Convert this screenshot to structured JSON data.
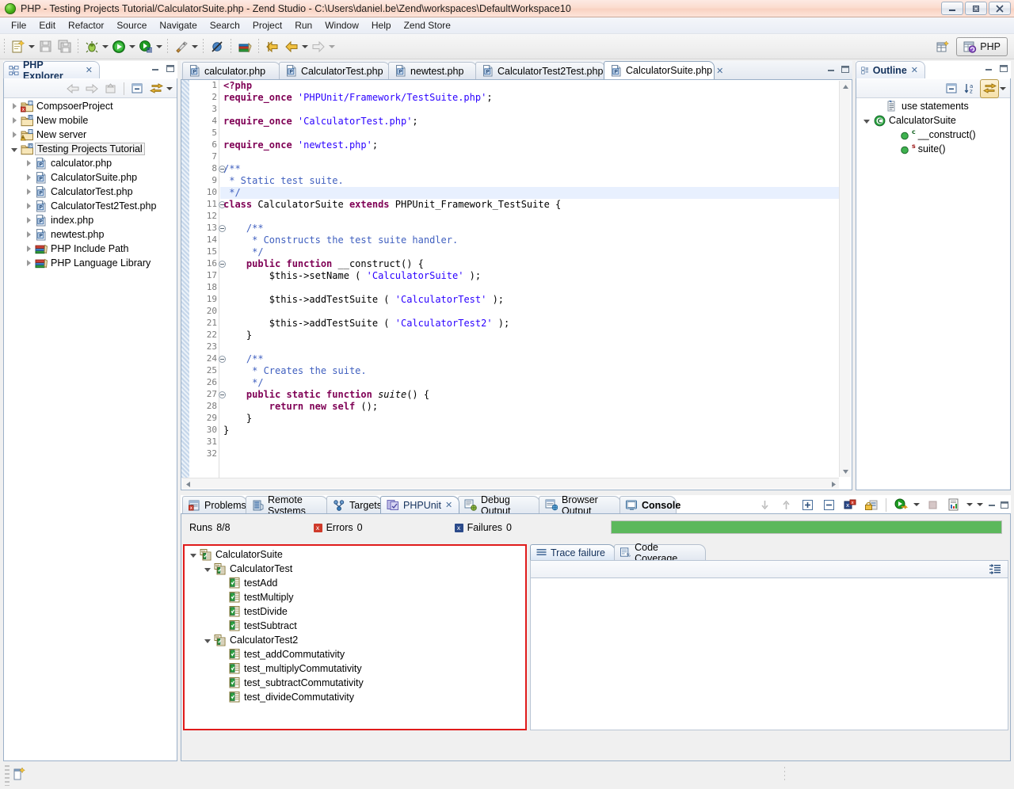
{
  "window": {
    "title": "PHP - Testing Projects Tutorial/CalculatorSuite.php - Zend Studio - C:\\Users\\daniel.be\\Zend\\workspaces\\DefaultWorkspace10",
    "minimize_label": "–",
    "maximize_label": "❐",
    "close_label": "✕"
  },
  "menu": {
    "items": [
      {
        "label": "File"
      },
      {
        "label": "Edit"
      },
      {
        "label": "Refactor"
      },
      {
        "label": "Source"
      },
      {
        "label": "Navigate"
      },
      {
        "label": "Search"
      },
      {
        "label": "Project"
      },
      {
        "label": "Run"
      },
      {
        "label": "Window"
      },
      {
        "label": "Help"
      },
      {
        "label": "Zend Store"
      }
    ]
  },
  "toolbar": {
    "buttons": [
      {
        "name": "new-wizard-icon",
        "tooltip": "New"
      },
      {
        "name": "save-icon",
        "tooltip": "Save"
      },
      {
        "name": "save-all-icon",
        "tooltip": "Save All"
      },
      {
        "name": "debug-icon",
        "tooltip": "Debug"
      },
      {
        "name": "run-icon",
        "tooltip": "Run"
      },
      {
        "name": "profile-icon",
        "tooltip": "Profile"
      },
      {
        "name": "launch-icon",
        "tooltip": "Run As"
      },
      {
        "name": "toggle-breakpoint-icon",
        "tooltip": "Skip All Breakpoints"
      },
      {
        "name": "open-type-icon",
        "tooltip": "Open Type"
      },
      {
        "name": "back-icon",
        "tooltip": "Back"
      },
      {
        "name": "previous-edit-icon",
        "tooltip": "Previous Edit Location"
      },
      {
        "name": "forward-icon",
        "tooltip": "Forward"
      }
    ],
    "perspective_label": "PHP",
    "open_perspective_tooltip": "Open Perspective"
  },
  "explorer": {
    "title": "PHP Explorer",
    "close_glyph": "✕",
    "toolbar": [
      {
        "name": "back-icon"
      },
      {
        "name": "forward-icon"
      },
      {
        "name": "up-icon"
      },
      {
        "name": "collapse-all-icon"
      },
      {
        "name": "link-with-editor-icon"
      },
      {
        "name": "view-menu-icon"
      }
    ],
    "tree": [
      {
        "label": "CompsoerProject",
        "indent": 0,
        "twist": "collapsed",
        "icon": "project-error-icon"
      },
      {
        "label": "New mobile",
        "indent": 0,
        "twist": "collapsed",
        "icon": "project-icon"
      },
      {
        "label": "New server",
        "indent": 0,
        "twist": "collapsed",
        "icon": "project-warning-icon"
      },
      {
        "label": "Testing Projects Tutorial",
        "indent": 0,
        "twist": "expanded",
        "icon": "project-icon",
        "selected": true
      },
      {
        "label": "calculator.php",
        "indent": 1,
        "twist": "collapsed",
        "icon": "php-file-icon"
      },
      {
        "label": "CalculatorSuite.php",
        "indent": 1,
        "twist": "collapsed",
        "icon": "php-file-icon"
      },
      {
        "label": "CalculatorTest.php",
        "indent": 1,
        "twist": "collapsed",
        "icon": "php-file-icon"
      },
      {
        "label": "CalculatorTest2Test.php",
        "indent": 1,
        "twist": "collapsed",
        "icon": "php-file-icon"
      },
      {
        "label": "index.php",
        "indent": 1,
        "twist": "collapsed",
        "icon": "php-file-icon"
      },
      {
        "label": "newtest.php",
        "indent": 1,
        "twist": "collapsed",
        "icon": "php-file-icon"
      },
      {
        "label": "PHP Include Path",
        "indent": 1,
        "twist": "collapsed",
        "icon": "library-icon"
      },
      {
        "label": "PHP Language Library",
        "indent": 1,
        "twist": "collapsed",
        "icon": "library-icon"
      }
    ]
  },
  "editor": {
    "tabs": [
      {
        "label": "calculator.php",
        "active": false
      },
      {
        "label": "CalculatorTest.php",
        "active": false
      },
      {
        "label": "newtest.php",
        "active": false
      },
      {
        "label": "CalculatorTest2Test.php",
        "active": false
      },
      {
        "label": "CalculatorSuite.php",
        "active": true,
        "close_glyph": "✕"
      }
    ],
    "minimize_glyph": "–",
    "maximize_glyph": "❐",
    "highlighted_line": 10,
    "fold_lines": [
      8,
      11,
      13,
      16,
      24,
      27
    ],
    "total_lines": 32,
    "lines": [
      {
        "n": 1,
        "tokens": [
          {
            "t": "<?php",
            "c": "k"
          }
        ]
      },
      {
        "n": 2,
        "tokens": [
          {
            "t": "require_once ",
            "c": "k"
          },
          {
            "t": "'PHPUnit/Framework/TestSuite.php'",
            "c": "s"
          },
          {
            "t": ";",
            "c": "t"
          }
        ]
      },
      {
        "n": 3,
        "tokens": []
      },
      {
        "n": 4,
        "tokens": [
          {
            "t": "require_once ",
            "c": "k"
          },
          {
            "t": "'CalculatorTest.php'",
            "c": "s"
          },
          {
            "t": ";",
            "c": "t"
          }
        ]
      },
      {
        "n": 5,
        "tokens": []
      },
      {
        "n": 6,
        "tokens": [
          {
            "t": "require_once ",
            "c": "k"
          },
          {
            "t": "'newtest.php'",
            "c": "s"
          },
          {
            "t": ";",
            "c": "t"
          }
        ]
      },
      {
        "n": 7,
        "tokens": []
      },
      {
        "n": 8,
        "tokens": [
          {
            "t": "/**",
            "c": "c"
          }
        ]
      },
      {
        "n": 9,
        "tokens": [
          {
            "t": " * Static test suite.",
            "c": "c"
          }
        ]
      },
      {
        "n": 10,
        "tokens": [
          {
            "t": " */",
            "c": "c"
          }
        ]
      },
      {
        "n": 11,
        "tokens": [
          {
            "t": "class ",
            "c": "k"
          },
          {
            "t": "CalculatorSuite ",
            "c": "t"
          },
          {
            "t": "extends ",
            "c": "k"
          },
          {
            "t": "PHPUnit_Framework_TestSuite {",
            "c": "t"
          }
        ]
      },
      {
        "n": 12,
        "tokens": []
      },
      {
        "n": 13,
        "tokens": [
          {
            "t": "    /**",
            "c": "c"
          }
        ]
      },
      {
        "n": 14,
        "tokens": [
          {
            "t": "     * Constructs the test suite handler.",
            "c": "c"
          }
        ]
      },
      {
        "n": 15,
        "tokens": [
          {
            "t": "     */",
            "c": "c"
          }
        ]
      },
      {
        "n": 16,
        "tokens": [
          {
            "t": "    public function ",
            "c": "k"
          },
          {
            "t": "__construct() {",
            "c": "t"
          }
        ]
      },
      {
        "n": 17,
        "tokens": [
          {
            "t": "        $this->setName ( ",
            "c": "t"
          },
          {
            "t": "'CalculatorSuite'",
            "c": "s"
          },
          {
            "t": " );",
            "c": "t"
          }
        ]
      },
      {
        "n": 18,
        "tokens": []
      },
      {
        "n": 19,
        "tokens": [
          {
            "t": "        $this->addTestSuite ( ",
            "c": "t"
          },
          {
            "t": "'CalculatorTest'",
            "c": "s"
          },
          {
            "t": " );",
            "c": "t"
          }
        ]
      },
      {
        "n": 20,
        "tokens": []
      },
      {
        "n": 21,
        "tokens": [
          {
            "t": "        $this->addTestSuite ( ",
            "c": "t"
          },
          {
            "t": "'CalculatorTest2'",
            "c": "s"
          },
          {
            "t": " );",
            "c": "t"
          }
        ]
      },
      {
        "n": 22,
        "tokens": [
          {
            "t": "    }",
            "c": "t"
          }
        ]
      },
      {
        "n": 23,
        "tokens": []
      },
      {
        "n": 24,
        "tokens": [
          {
            "t": "    /**",
            "c": "c"
          }
        ]
      },
      {
        "n": 25,
        "tokens": [
          {
            "t": "     * Creates the suite.",
            "c": "c"
          }
        ]
      },
      {
        "n": 26,
        "tokens": [
          {
            "t": "     */",
            "c": "c"
          }
        ]
      },
      {
        "n": 27,
        "tokens": [
          {
            "t": "    public static function ",
            "c": "k"
          },
          {
            "t": "suite",
            "c": "t ital"
          },
          {
            "t": "() {",
            "c": "t"
          }
        ]
      },
      {
        "n": 28,
        "tokens": [
          {
            "t": "        return new self ",
            "c": "k"
          },
          {
            "t": "();",
            "c": "t"
          }
        ]
      },
      {
        "n": 29,
        "tokens": [
          {
            "t": "    }",
            "c": "t"
          }
        ]
      },
      {
        "n": 30,
        "tokens": [
          {
            "t": "}",
            "c": "t"
          }
        ]
      },
      {
        "n": 31,
        "tokens": []
      },
      {
        "n": 32,
        "tokens": []
      }
    ]
  },
  "outline": {
    "title": "Outline",
    "close_glyph": "✕",
    "toolbar": [
      {
        "name": "collapse-all-icon"
      },
      {
        "name": "sort-icon"
      },
      {
        "name": "link-with-editor-icon"
      },
      {
        "name": "view-menu-icon"
      }
    ],
    "tree": [
      {
        "label": "use statements",
        "indent": 1,
        "twist": "none",
        "icon": "use-statements-icon"
      },
      {
        "label": "CalculatorSuite",
        "indent": 0,
        "twist": "expanded",
        "icon": "class-icon"
      },
      {
        "label": "__construct()",
        "indent": 2,
        "twist": "none",
        "icon": "method-public-icon",
        "badge": "c"
      },
      {
        "label": "suite()",
        "indent": 2,
        "twist": "none",
        "icon": "method-public-icon",
        "badge": "s"
      }
    ]
  },
  "bottom": {
    "tabs": [
      {
        "label": "Problems",
        "icon": "problems-icon",
        "active": false,
        "bold": false
      },
      {
        "label": "Remote Systems",
        "icon": "remote-systems-icon",
        "active": false,
        "bold": false
      },
      {
        "label": "Targets",
        "icon": "targets-icon",
        "active": false,
        "bold": false
      },
      {
        "label": "PHPUnit",
        "icon": "phpunit-icon",
        "active": true,
        "bold": false,
        "close_glyph": "✕"
      },
      {
        "label": "Debug Output",
        "icon": "debug-output-icon",
        "active": false,
        "bold": false
      },
      {
        "label": "Browser Output",
        "icon": "browser-output-icon",
        "active": false,
        "bold": false
      },
      {
        "label": "Console",
        "icon": "console-icon",
        "active": false,
        "bold": true
      }
    ],
    "toolbar": [
      {
        "name": "next-failure-icon"
      },
      {
        "name": "previous-failure-icon"
      },
      {
        "name": "expand-all-icon"
      },
      {
        "name": "collapse-all-icon"
      },
      {
        "name": "show-failures-only-icon"
      },
      {
        "name": "lock-scroll-icon"
      },
      {
        "name": "rerun-test-icon"
      },
      {
        "name": "rerun-dropdown-icon"
      },
      {
        "name": "stop-icon"
      },
      {
        "name": "report-icon"
      },
      {
        "name": "report-dropdown-icon"
      },
      {
        "name": "view-menu-icon"
      },
      {
        "name": "minimize-icon"
      },
      {
        "name": "maximize-icon"
      }
    ],
    "status": {
      "runs_label": "Runs",
      "runs_value": "8/8",
      "errors_label": "Errors",
      "errors_value": "0",
      "failures_label": "Failures",
      "failures_value": "0",
      "progress_percent": 100,
      "progress_color": "#5cb85c"
    },
    "test_tree": [
      {
        "label": "CalculatorSuite",
        "indent": 0,
        "twist": "expanded",
        "icon": "test-suite-icon"
      },
      {
        "label": "CalculatorTest",
        "indent": 1,
        "twist": "expanded",
        "icon": "test-suite-icon"
      },
      {
        "label": "testAdd",
        "indent": 2,
        "twist": "none",
        "icon": "test-case-icon"
      },
      {
        "label": "testMultiply",
        "indent": 2,
        "twist": "none",
        "icon": "test-case-icon"
      },
      {
        "label": "testDivide",
        "indent": 2,
        "twist": "none",
        "icon": "test-case-icon"
      },
      {
        "label": "testSubtract",
        "indent": 2,
        "twist": "none",
        "icon": "test-case-icon"
      },
      {
        "label": "CalculatorTest2",
        "indent": 1,
        "twist": "expanded",
        "icon": "test-suite-icon"
      },
      {
        "label": "test_addCommutativity",
        "indent": 2,
        "twist": "none",
        "icon": "test-case-icon"
      },
      {
        "label": "test_multiplyCommutativity",
        "indent": 2,
        "twist": "none",
        "icon": "test-case-icon"
      },
      {
        "label": "test_subtractCommutativity",
        "indent": 2,
        "twist": "none",
        "icon": "test-case-icon"
      },
      {
        "label": "test_divideCommutativity",
        "indent": 2,
        "twist": "none",
        "icon": "test-case-icon"
      }
    ],
    "trace": {
      "tabs": [
        {
          "label": "Trace failure",
          "icon": "trace-failure-icon",
          "active": true
        },
        {
          "label": "Code Coverage",
          "icon": "code-coverage-icon",
          "active": false
        }
      ],
      "toolbar": [
        {
          "name": "filter-stack-trace-icon"
        }
      ],
      "content": ""
    }
  },
  "statusbar": {
    "left_icon": "writable-indicator-icon",
    "text": ""
  },
  "colors": {
    "titlebar": "#fbdccf",
    "accent_tab": "#14325c",
    "progress_green": "#5cb85c",
    "selection_red_border": "#e01b1b",
    "keyword": "#7f0055",
    "string": "#2a00ff",
    "comment": "#3f5fbf"
  }
}
